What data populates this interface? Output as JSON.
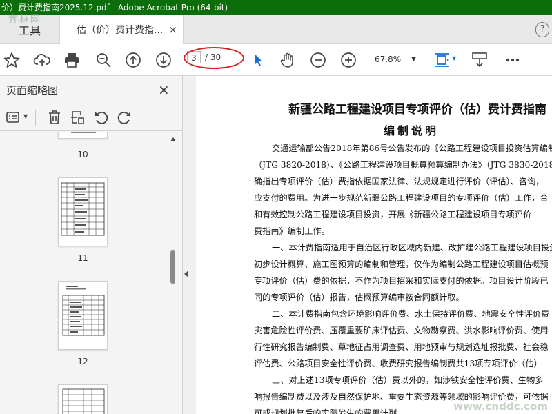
{
  "window": {
    "title": "价）费计费指南2025.12.pdf - Adobe Acrobat Pro (64-bit)"
  },
  "tabs": {
    "tools_label": "工具",
    "doc_label": "估（价）费计费指...",
    "close": "×",
    "help": "?",
    "watermark": "宜林网"
  },
  "toolbar": {
    "page_current": "3",
    "page_total": "/ 30",
    "zoom": "67.8%",
    "icons": [
      "star-icon",
      "cloud-upload-icon",
      "print-icon",
      "zoom-search-icon",
      "page-up-icon",
      "page-down-icon",
      "cursor-icon",
      "hand-icon",
      "zoom-out-icon",
      "zoom-in-icon",
      "fit-page-icon",
      "scroll-mode-icon",
      "more-icon"
    ]
  },
  "sidebar": {
    "title": "页面缩略图",
    "close": "×",
    "thumbnails": [
      {
        "label": "10"
      },
      {
        "label": "11"
      },
      {
        "label": "12"
      }
    ]
  },
  "document": {
    "title": "新疆公路工程建设项目专项评价（估）费计费指南",
    "subtitle": "编制说明",
    "lines": [
      "交通运输部公告2018年第86号公告发布的《公路工程建设项目投资估算编制",
      "（JTG 3820-2018）、《公路工程建设项目概算预算编制办法》（JTG 3830-2018",
      "确指出专项评价（估）费指依据国家法律、法规规定进行评价（评估）、咨询，",
      "应支付的费用。为进一步规范新疆公路工程建设项目的专项评价（估）工作，合",
      "和有效控制公路工程建设项目投资，开展《新疆公路工程建设项目专项评价",
      "费指南》编制工作。",
      "一、本计费指南适用于自治区行政区域内新建、改扩建公路工程建设项目投资",
      "初步设计概算、施工图预算的编制和管理，仅作为编制公路工程建设项目估概预",
      "专项评价（估）费的依据，不作为项目招采和实际支付的依据。项目设计阶段已",
      "同的专项评价（估）报告，估概预算编审按合同额计取。",
      "二、本计费指南包含环境影响评价费、水土保持评价费、地震安全性评价费",
      "灾害危险性评价费、压覆重要矿床评估费、文物勘察费、洪水影响评价费、使用",
      "行性研究报告编制费、草地征占用调查费、用地预审与规划选址报批费、社会稳",
      "评估费、公路项目安全性评价费、收费研究报告编制费共13项专项评价（估）",
      "三、对上述13项专项评价（估）费以外的，如涉铁安全性评价费、生物多",
      "响报告编制费以及涉及自然保护地、重要生态资源等领域的影响评价费，可依据",
      "可或规划批复后的实际发生的费用计列。"
    ]
  },
  "corner_watermark": "www.cnddc.com"
}
